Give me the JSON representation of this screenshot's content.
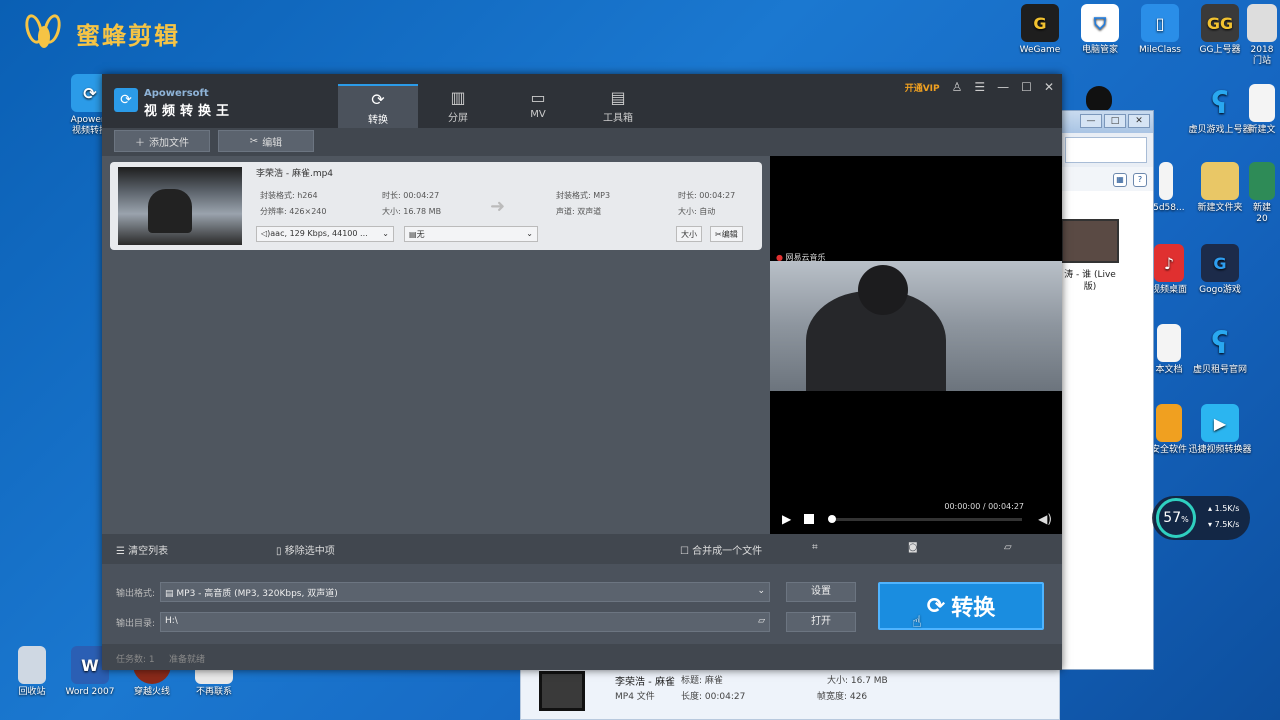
{
  "watermark": {
    "text": "蜜蜂剪辑"
  },
  "desktop_icons": {
    "wegame": "WeGame",
    "pcmanager": "电脑管家",
    "mileclass": "MileClass",
    "gg": "GG上号器",
    "gg_abbr": "GG",
    "partial_2018": "2018",
    "partial_2018b": "门站",
    "apowersoft_left": "Apowers",
    "apowersoft_left2": "视频转换",
    "recycle": "回收站",
    "word": "Word 2007",
    "word_abbr": "W",
    "chuanyue": "穿越火线",
    "buzai": "不再联系",
    "xubei1": "虚贝游戏上号器",
    "newdoc1": "新建文",
    "newfolder": "新建文件夹",
    "newdoc2": "新建",
    "newdoc2b": "20",
    "d58": "75d58...",
    "desktop_video": "视频桌面",
    "gogo": "Gogo游戏",
    "textdoc": "本文档",
    "xubei2": "虚贝租号官网",
    "safe": "安全软件",
    "xunjie": "迅捷视频转换器"
  },
  "explorer": {
    "caption": "涛 - 谁 (Live 版)",
    "min": "—",
    "max": "□",
    "close": "✕",
    "view_btn": "▦",
    "help_btn": "?"
  },
  "detailbar": {
    "title": "李荣浩 - 麻雀",
    "type": "MP4 文件",
    "title_label": "标题: 麻雀",
    "length": "长度: 00:04:27",
    "size": "大小: 16.7 MB",
    "width": "帧宽度: 426"
  },
  "app": {
    "brand_small": "Apowersoft",
    "brand_big": "视频转换王",
    "tabs": [
      {
        "icon": "⟳",
        "label": "转换"
      },
      {
        "icon": "▥",
        "label": "分屏"
      },
      {
        "icon": "▭",
        "label": "MV"
      },
      {
        "icon": "▤",
        "label": "工具箱"
      }
    ],
    "vip": "开通VIP",
    "toolbar": {
      "add_file": "添加文件",
      "edit": "编辑"
    },
    "file": {
      "name": "李荣浩 - 麻雀.mp4",
      "in_format": "封装格式: h264",
      "in_res": "分辨率: 426×240",
      "in_duration": "时长: 00:04:27",
      "in_size": "大小: 16.78 MB",
      "out_format": "封装格式: MP3",
      "out_channel": "声道: 双声道",
      "out_duration": "时长: 00:04:27",
      "out_size": "大小: 自动",
      "audio": "aac, 129 Kbps, 44100 ...",
      "subtitle": "无",
      "size_btn": "大小",
      "edit_btn": "编辑"
    },
    "preview": {
      "logo": "网易云音乐",
      "time": "00:00:00 / 00:04:27",
      "progress": 0
    },
    "listbar": {
      "clear": "清空列表",
      "remove": "移除选中项",
      "merge": "合并成一个文件"
    },
    "output": {
      "format_label": "输出格式:",
      "format_value": "MP3 - 高音质 (MP3, 320Kbps, 双声道)",
      "dir_label": "输出目录:",
      "dir_value": "H:\\",
      "settings": "设置",
      "open": "打开",
      "convert": "转换"
    },
    "status": {
      "tasks": "任务数: 1",
      "state": "准备就绪"
    }
  },
  "netwidget": {
    "percent": "57",
    "unit": "%",
    "up": "1.5",
    "down": "7.5",
    "speed_unit": "K/s"
  }
}
